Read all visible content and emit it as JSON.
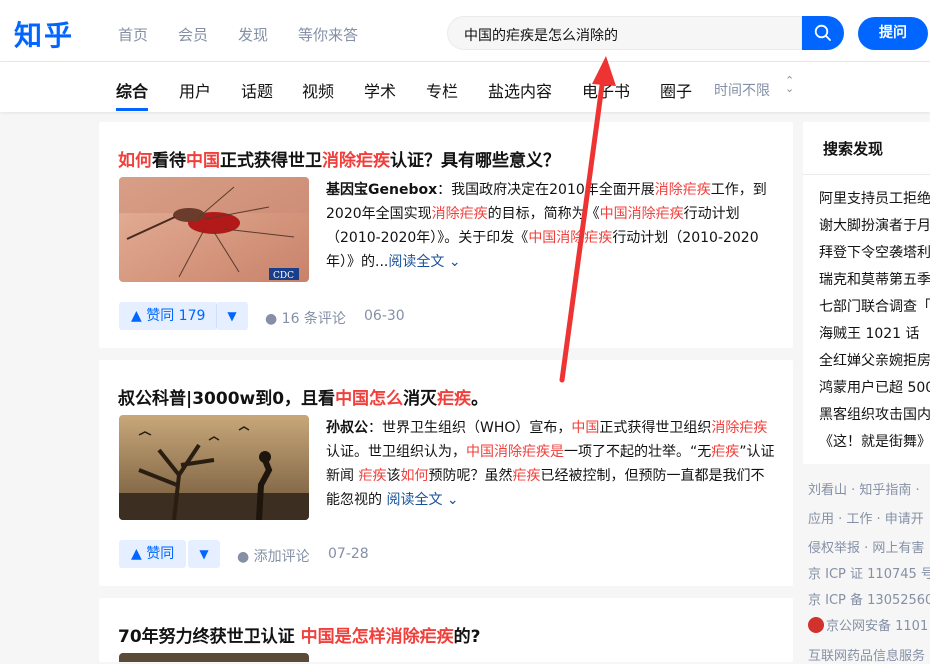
{
  "header": {
    "logo": "知乎",
    "nav": [
      "首页",
      "会员",
      "发现",
      "等你来答"
    ],
    "search_value": "中国的疟疾是怎么消除的",
    "ask_label": "提问"
  },
  "tabs": [
    "综合",
    "用户",
    "话题",
    "视频",
    "学术",
    "专栏",
    "盐选内容",
    "电子书",
    "圈子"
  ],
  "time_filter": "时间不限",
  "results": [
    {
      "title_parts": [
        [
          "如何",
          true
        ],
        [
          "看待",
          false
        ],
        [
          "中国",
          true
        ],
        [
          "正式获得世卫",
          false
        ],
        [
          "消除疟疾",
          true
        ],
        [
          "认证？具有哪些意义？",
          false
        ]
      ],
      "author": "基因宝Genebox",
      "excerpt_parts": [
        [
          "：我国政府决定在2010年全面开展",
          false
        ],
        [
          "消除疟疾",
          true
        ],
        [
          "工作，到2020年全国实现",
          false
        ],
        [
          "消除疟疾",
          true
        ],
        [
          "的目标，简称为《",
          false
        ],
        [
          "中国消除疟疾",
          true
        ],
        [
          "行动计划（2010-2020年）》。关于印发《",
          false
        ],
        [
          "中国消除疟疾",
          true
        ],
        [
          "行动计划（2010-2020年）》的...",
          false
        ]
      ],
      "read_more": "阅读全文",
      "upvote": "赞同 179",
      "comments": "16 条评论",
      "date": "06-30"
    },
    {
      "title_parts": [
        [
          "叔公科普|3000w到0，且看",
          false
        ],
        [
          "中国怎么",
          true
        ],
        [
          "消灭",
          false
        ],
        [
          "疟疾",
          true
        ],
        [
          "。",
          false
        ]
      ],
      "author": "孙叔公",
      "excerpt_parts": [
        [
          "：世界卫生组织（WHO）宣布，",
          false
        ],
        [
          "中国",
          true
        ],
        [
          "正式获得世卫组织",
          false
        ],
        [
          "消除疟疾",
          true
        ],
        [
          "认证。世卫组织认为，",
          false
        ],
        [
          "中国消除疟疾是",
          true
        ],
        [
          "一项了不起的壮举。“无",
          false
        ],
        [
          "疟疾",
          true
        ],
        [
          "”认证新闻 ",
          false
        ],
        [
          "疟疾",
          true
        ],
        [
          "该",
          false
        ],
        [
          "如何",
          true
        ],
        [
          "预防呢？虽然",
          false
        ],
        [
          "疟疾",
          true
        ],
        [
          "已经被控制，但预防一直都是我们不能忽视的 ",
          false
        ]
      ],
      "read_more": "阅读全文",
      "upvote": "赞同",
      "comments": "添加评论",
      "date": "07-28"
    },
    {
      "title_parts": [
        [
          "70年努力终获世卫认证 ",
          false
        ],
        [
          "中国是怎样消除疟疾",
          true
        ],
        [
          "的?",
          false
        ]
      ]
    }
  ],
  "sidebar": {
    "title": "搜索发现",
    "items": [
      "阿里支持员工拒绝",
      "谢大脚扮演者于月",
      "拜登下令空袭塔利",
      "瑞克和莫蒂第五季",
      "七部门联合调查「",
      "海贼王 1021 话",
      "全红婵父亲婉拒房",
      "鸿蒙用户已超 500",
      "黑客组织攻击国内",
      "《这！就是街舞》"
    ]
  },
  "footer": [
    "刘看山 · 知乎指南 ·",
    "应用 · 工作 · 申请开",
    "侵权举报 · 网上有害",
    "京 ICP 证 110745 号",
    "京 ICP 备 13052560",
    "京公网安备 1101",
    "互联网药品信息服务"
  ],
  "colors": {
    "accent": "#0066ff",
    "highlight": "#f1403c",
    "arrow": "#ee3333"
  }
}
